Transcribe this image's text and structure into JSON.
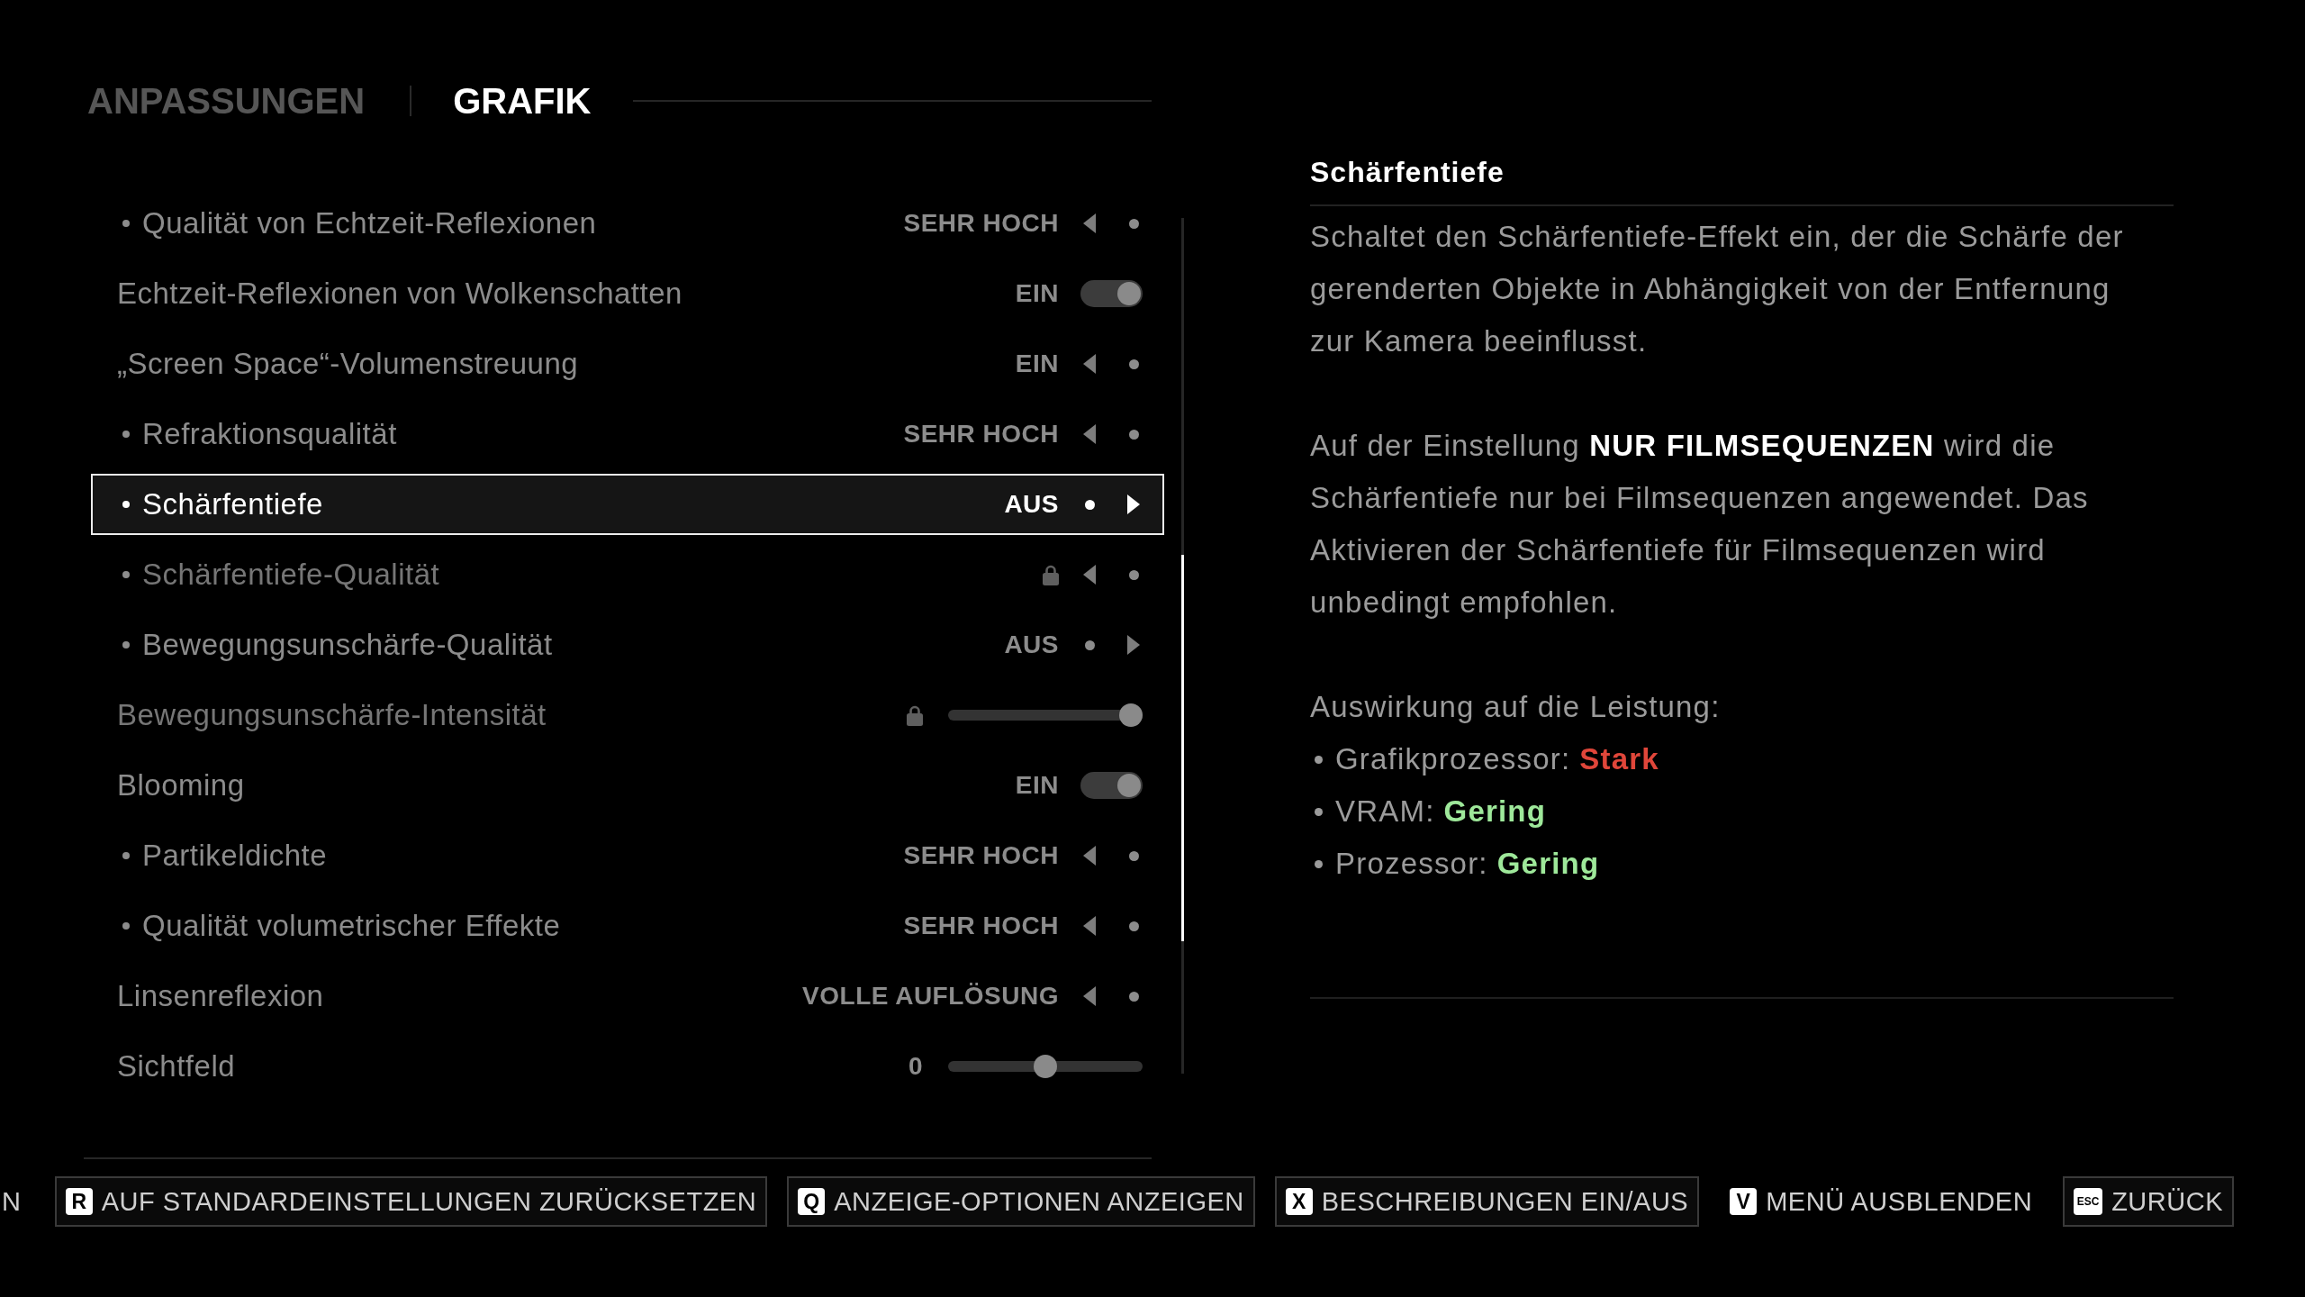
{
  "tabs": [
    {
      "label": "ANPASSUNGEN",
      "selected": false
    },
    {
      "label": "GRAFIK",
      "selected": true
    }
  ],
  "rows": [
    {
      "kind": "selector",
      "label": "Qualität von Echtzeit-Reflexionen",
      "bullet": true,
      "selected": false,
      "locked": false,
      "value": "SEHR HOCH",
      "can_decrease": true,
      "can_increase": false
    },
    {
      "kind": "toggle",
      "label": "Echtzeit-Reflexionen von Wolkenschatten",
      "bullet": false,
      "selected": false,
      "locked": false,
      "value": "EIN",
      "on": true
    },
    {
      "kind": "selector",
      "label": "„Screen Space“-Volumenstreuung",
      "bullet": false,
      "selected": false,
      "locked": false,
      "value": "EIN",
      "can_decrease": true,
      "can_increase": false
    },
    {
      "kind": "selector",
      "label": "Refraktionsqualität",
      "bullet": true,
      "selected": false,
      "locked": false,
      "value": "SEHR HOCH",
      "can_decrease": true,
      "can_increase": false
    },
    {
      "kind": "selector",
      "label": "Schärfentiefe",
      "bullet": true,
      "selected": true,
      "locked": false,
      "value": "AUS",
      "can_decrease": false,
      "can_increase": true
    },
    {
      "kind": "selector",
      "label": "Schärfentiefe-Qualität",
      "bullet": true,
      "selected": false,
      "locked": true,
      "can_decrease": true,
      "can_increase": false
    },
    {
      "kind": "selector",
      "label": "Bewegungsunschärfe-Qualität",
      "bullet": true,
      "selected": false,
      "locked": false,
      "value": "AUS",
      "can_decrease": false,
      "can_increase": true
    },
    {
      "kind": "slider",
      "label": "Bewegungsunschärfe-Intensität",
      "bullet": false,
      "selected": false,
      "locked": true,
      "level": 1
    },
    {
      "kind": "toggle",
      "label": "Blooming",
      "bullet": false,
      "selected": false,
      "locked": false,
      "value": "EIN",
      "on": true
    },
    {
      "kind": "selector",
      "label": "Partikeldichte",
      "bullet": true,
      "selected": false,
      "locked": false,
      "value": "SEHR HOCH",
      "can_decrease": true,
      "can_increase": false
    },
    {
      "kind": "selector",
      "label": "Qualität volumetrischer Effekte",
      "bullet": true,
      "selected": false,
      "locked": false,
      "value": "SEHR HOCH",
      "can_decrease": true,
      "can_increase": false
    },
    {
      "kind": "selector",
      "label": "Linsenreflexion",
      "bullet": false,
      "selected": false,
      "locked": false,
      "value": "VOLLE AUFLÖSUNG",
      "can_decrease": true,
      "can_increase": false
    },
    {
      "kind": "slider",
      "label": "Sichtfeld",
      "bullet": false,
      "selected": false,
      "locked": false,
      "value": "0",
      "level": 0.5
    }
  ],
  "description": {
    "title": "Schärfentiefe",
    "paragraphs": [
      "Schaltet den Schärfentiefe-Effekt ein, der die Schärfe der\ngerenderten Objekte in Abhängigkeit von der Entfernung\nzur Kamera beeinflusst.",
      "Auf der Einstellung **NUR FILMSEQUENZEN** wird die\nSchärfentiefe nur bei Filmsequenzen angewendet. Das\nAktivieren der Schärfentiefe für Filmsequenzen wird\nunbedingt empfohlen."
    ],
    "impact": {
      "heading": "Auswirkung auf die Leistung:",
      "items": [
        {
          "label": "Grafikprozessor:",
          "value": "Stark",
          "color": "#e0463a"
        },
        {
          "label": "VRAM:",
          "value": "Gering",
          "color": "#9ee89a"
        },
        {
          "label": "Prozessor:",
          "value": "Gering",
          "color": "#9ee89a"
        }
      ]
    }
  },
  "footer": [
    {
      "label": "N",
      "framed": false
    },
    {
      "key": "R",
      "label": "AUF STANDARDEINSTELLUNGEN ZURÜCKSETZEN",
      "framed": true
    },
    {
      "key": "Q",
      "label": "ANZEIGE-OPTIONEN ANZEIGEN",
      "framed": true
    },
    {
      "key": "X",
      "label": "BESCHREIBUNGEN EIN/AUS",
      "framed": true
    },
    {
      "key": "V",
      "label": "MENÜ AUSBLENDEN",
      "framed": false
    },
    {
      "key": "ESC",
      "label": "ZURÜCK",
      "framed": true
    }
  ]
}
